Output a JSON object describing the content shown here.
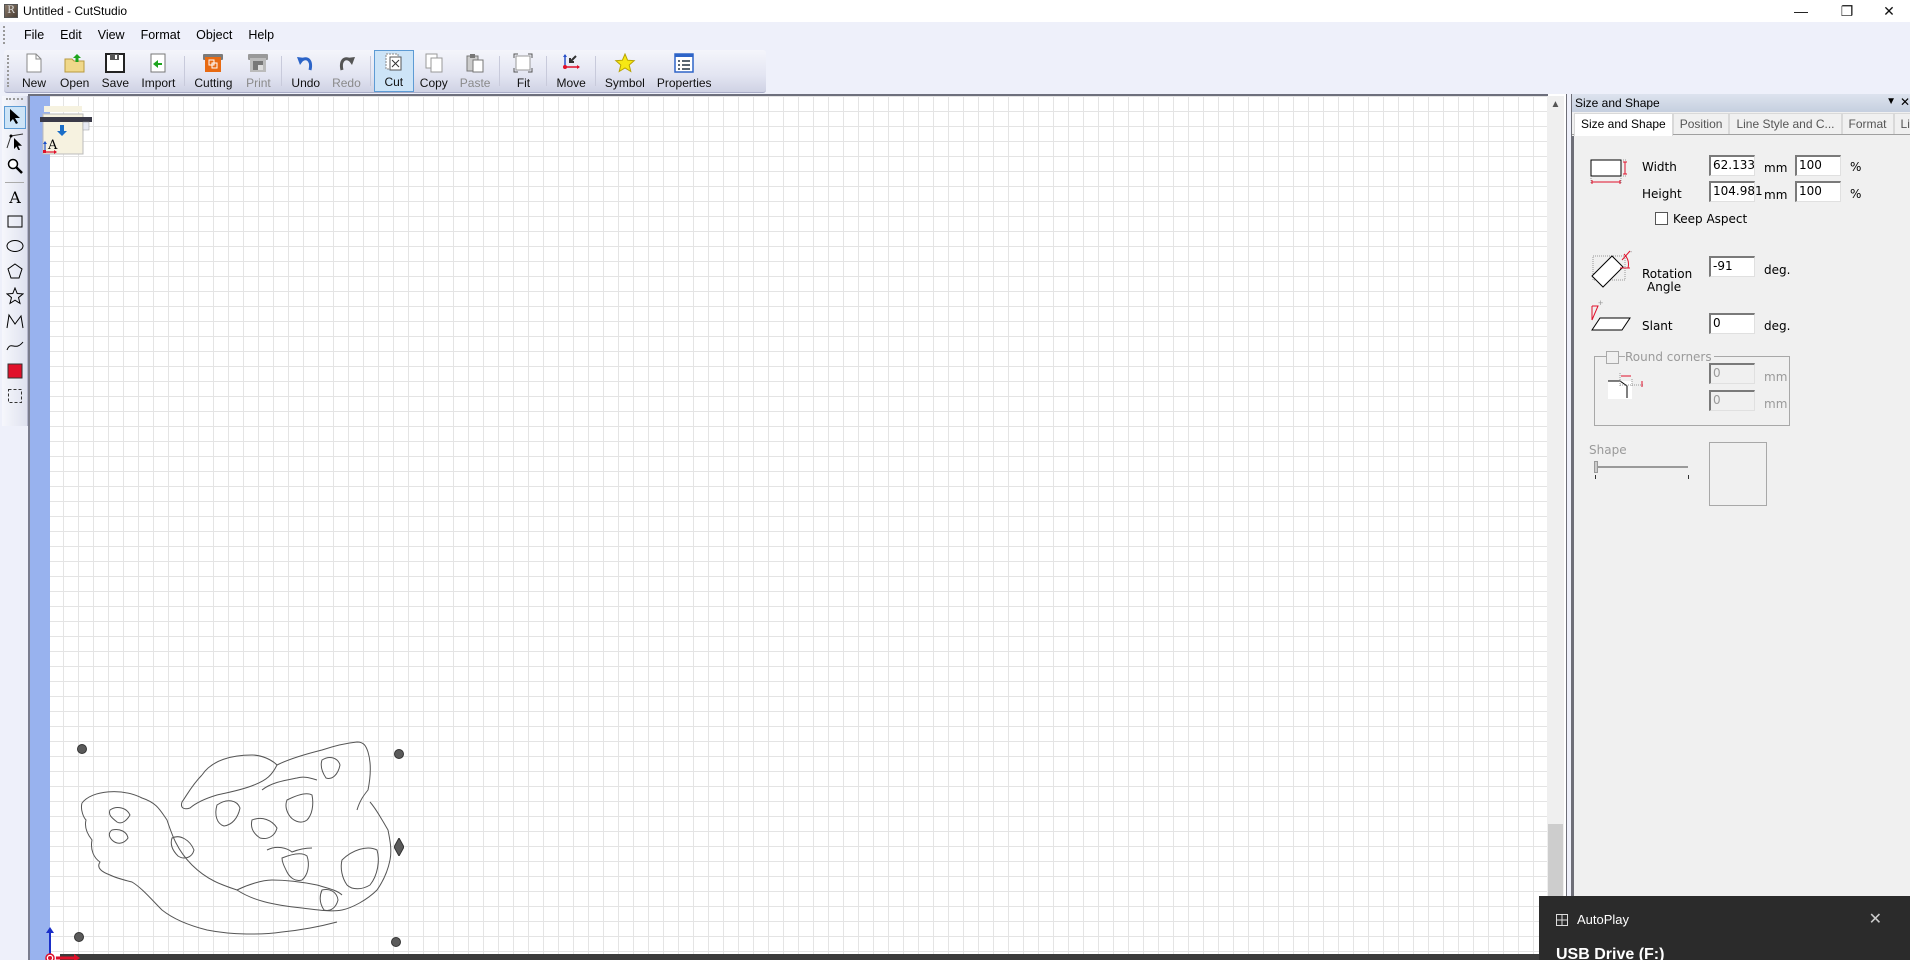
{
  "window": {
    "title": "Untitled - CutStudio",
    "app_icon": "cutstudio-icon",
    "controls": {
      "minimize": "—",
      "restore": "❐",
      "close": "✕"
    }
  },
  "menu": {
    "items": [
      "File",
      "Edit",
      "View",
      "Format",
      "Object",
      "Help"
    ]
  },
  "toolbar": {
    "buttons": [
      {
        "label": "New",
        "icon": "new-document-icon",
        "enabled": true
      },
      {
        "label": "Open",
        "icon": "open-folder-icon",
        "enabled": true
      },
      {
        "label": "Save",
        "icon": "save-floppy-icon",
        "enabled": true
      },
      {
        "label": "Import",
        "icon": "import-icon",
        "enabled": true
      },
      {
        "label": "Cutting",
        "icon": "cutting-icon",
        "enabled": true
      },
      {
        "label": "Print",
        "icon": "print-icon",
        "enabled": false
      },
      {
        "label": "Undo",
        "icon": "undo-icon",
        "enabled": true
      },
      {
        "label": "Redo",
        "icon": "redo-icon",
        "enabled": false
      },
      {
        "label": "Cut",
        "icon": "cut-icon",
        "enabled": true,
        "active": true
      },
      {
        "label": "Copy",
        "icon": "copy-icon",
        "enabled": true
      },
      {
        "label": "Paste",
        "icon": "paste-icon",
        "enabled": false
      },
      {
        "label": "Fit",
        "icon": "fit-icon",
        "enabled": true
      },
      {
        "label": "Move",
        "icon": "move-icon",
        "enabled": true
      },
      {
        "label": "Symbol",
        "icon": "star-symbol-icon",
        "enabled": true
      },
      {
        "label": "Properties",
        "icon": "properties-icon",
        "enabled": true
      }
    ]
  },
  "toolbox": {
    "tools": [
      "select-arrow-icon",
      "edit-points-icon",
      "zoom-magnifier-icon",
      "text-tool-icon",
      "rectangle-tool-icon",
      "ellipse-tool-icon",
      "polygon-tool-icon",
      "star-tool-icon",
      "polyline-tool-icon",
      "curve-tool-icon",
      "fill-color-icon",
      "selection-frame-icon"
    ],
    "active": "select-arrow-icon"
  },
  "canvas": {
    "media_marker_icon": "media-origin-icon",
    "artwork": "flame-animal-head-outline",
    "origin_icon": "origin-axes-icon"
  },
  "panel": {
    "title": "Size and Shape",
    "tabs": [
      "Size and Shape",
      "Position",
      "Line Style and C...",
      "Format",
      "Links"
    ],
    "active_tab": "Size and Shape",
    "width_label": "Width",
    "width_value": "62.133",
    "width_unit": "mm",
    "width_percent": "100",
    "height_label": "Height",
    "height_value": "104.981",
    "height_unit": "mm",
    "height_percent": "100",
    "percent_sign": "%",
    "keep_aspect_label": "Keep Aspect",
    "keep_aspect_checked": false,
    "rotation_label_1": "Rotation",
    "rotation_label_2": "Angle",
    "rotation_value": "-91",
    "rotation_unit": "deg.",
    "slant_label": "Slant",
    "slant_value": "0",
    "slant_unit": "deg.",
    "round_corners_label": "Round corners",
    "round_corners_checked": false,
    "round_x": "0",
    "round_y": "0",
    "round_unit": "mm",
    "shape_label": "Shape",
    "shape_slider_value": 0
  },
  "notification": {
    "app": "AutoPlay",
    "subtitle": "USB Drive (F:)",
    "close": "✕"
  }
}
